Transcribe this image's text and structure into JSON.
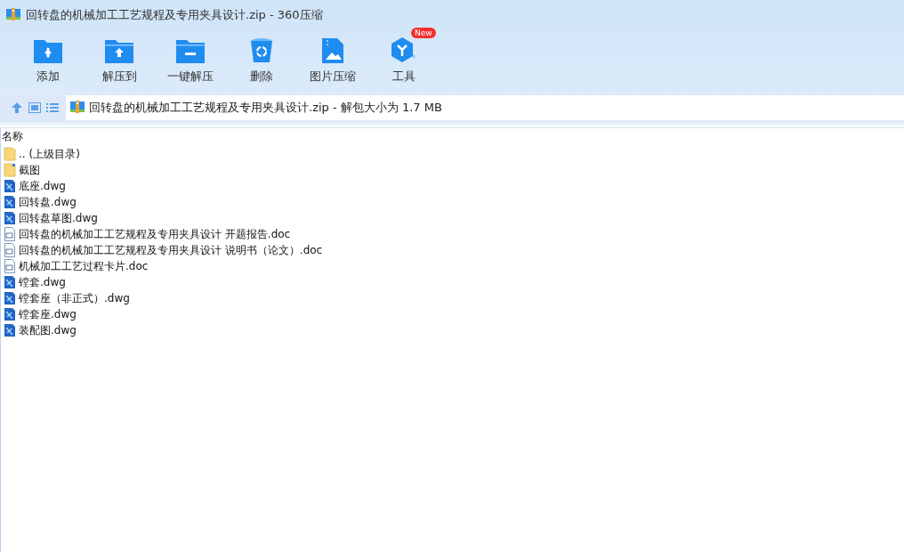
{
  "window": {
    "title": "回转盘的机械加工工艺规程及专用夹具设计.zip - 360压缩"
  },
  "toolbar": [
    {
      "kind": "add",
      "label": "添加"
    },
    {
      "kind": "extract",
      "label": "解压到"
    },
    {
      "kind": "quick",
      "label": "一键解压"
    },
    {
      "kind": "delete",
      "label": "删除"
    },
    {
      "kind": "image",
      "label": "图片压缩"
    },
    {
      "kind": "tools",
      "label": "工具",
      "badge": "New"
    }
  ],
  "address": {
    "path": "回转盘的机械加工工艺规程及专用夹具设计.zip - 解包大小为 1.7 MB"
  },
  "file_list": {
    "columns": [
      "名称"
    ],
    "rows": [
      {
        "kind": "parent",
        "name": ".. (上级目录)"
      },
      {
        "kind": "folder",
        "name": "截图"
      },
      {
        "kind": "dwg",
        "name": "底座.dwg"
      },
      {
        "kind": "dwg",
        "name": "回转盘.dwg"
      },
      {
        "kind": "dwg",
        "name": "回转盘草图.dwg"
      },
      {
        "kind": "doc",
        "name": "回转盘的机械加工工艺规程及专用夹具设计 开题报告.doc"
      },
      {
        "kind": "doc",
        "name": "回转盘的机械加工工艺规程及专用夹具设计 说明书（论文）.doc"
      },
      {
        "kind": "doc",
        "name": "机械加工工艺过程卡片.doc"
      },
      {
        "kind": "dwg",
        "name": "镗套.dwg"
      },
      {
        "kind": "dwg",
        "name": "镗套座（非正式）.dwg"
      },
      {
        "kind": "dwg",
        "name": "镗套座.dwg"
      },
      {
        "kind": "dwg",
        "name": "装配图.dwg"
      }
    ]
  }
}
